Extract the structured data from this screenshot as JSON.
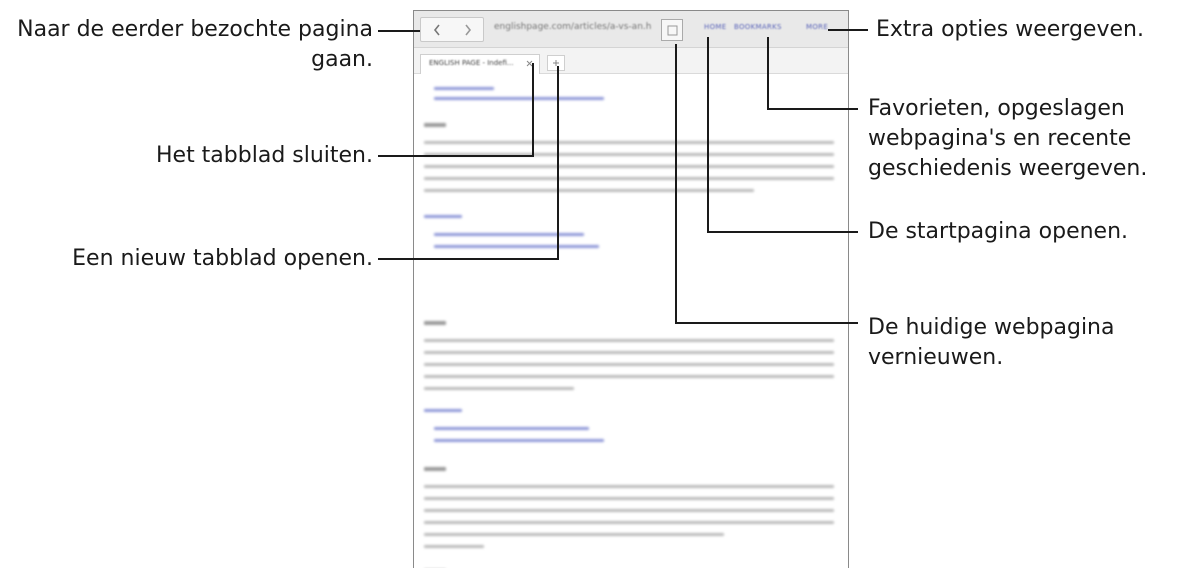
{
  "browser": {
    "url": "englishpage.com/articles/a-vs-an.h",
    "top_menu": [
      "HOME",
      "BOOKMARKS",
      "MORE"
    ],
    "tab_title": "ENGLISH PAGE - Indefi..."
  },
  "labels": {
    "back": "Naar de eerder bezochte pagina",
    "back_2": "gaan.",
    "close_tab": "Het tabblad sluiten.",
    "new_tab": "Een nieuw tabblad openen.",
    "more": "Extra opties weergeven.",
    "bookmarks_1": "Favorieten, opgeslagen",
    "bookmarks_2": "webpagina's en recente",
    "bookmarks_3": "geschiedenis weergeven.",
    "home": "De startpagina openen.",
    "refresh_1": "De huidige webpagina",
    "refresh_2": "vernieuwen."
  },
  "icons": [
    "chevron-left-icon",
    "chevron-right-icon",
    "refresh-icon",
    "close-icon",
    "plus-icon"
  ]
}
